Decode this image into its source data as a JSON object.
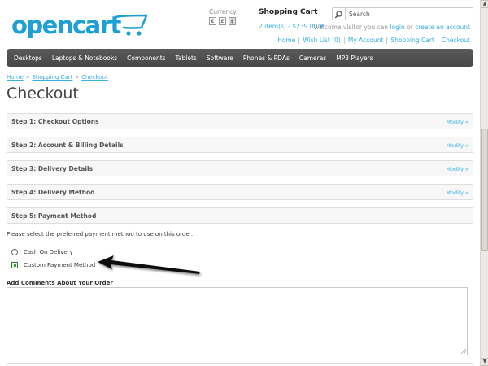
{
  "header": {
    "logo_text": "opencart",
    "currency_label": "Currency",
    "currencies": [
      "€",
      "£",
      "$"
    ],
    "cart_title": "Shopping Cart",
    "cart_summary": "2 item(s) - $239.00",
    "search_placeholder": "Search",
    "welcome_prefix": "Welcome visitor you can",
    "welcome_login": "login",
    "welcome_or": "or",
    "welcome_register": "create an account",
    "links": [
      "Home",
      "Wish List (0)",
      "My Account",
      "Shopping Cart",
      "Checkout"
    ]
  },
  "menu": [
    "Desktops",
    "Laptops & Notebooks",
    "Components",
    "Tablets",
    "Software",
    "Phones & PDAs",
    "Cameras",
    "MP3 Players"
  ],
  "breadcrumb": [
    "Home",
    "Shopping Cart",
    "Checkout"
  ],
  "breadcrumb_separator": "»",
  "page_title": "Checkout",
  "steps": [
    {
      "title": "Step 1: Checkout Options",
      "modify": "Modify »"
    },
    {
      "title": "Step 2: Account & Billing Details",
      "modify": "Modify »"
    },
    {
      "title": "Step 3: Delivery Details",
      "modify": "Modify »"
    },
    {
      "title": "Step 4: Delivery Method",
      "modify": "Modify »"
    },
    {
      "title": "Step 5: Payment Method",
      "modify": ""
    }
  ],
  "payment": {
    "instruction": "Please select the preferred payment method to use on this order.",
    "options": [
      {
        "label": "Cash On Delivery",
        "selected": false
      },
      {
        "label": "Custom Payment Method",
        "selected": true
      }
    ]
  },
  "comments": {
    "label": "Add Comments About Your Order",
    "value": ""
  },
  "colors": {
    "brand": "#1da0d6",
    "link": "#38b0e3",
    "menu_bg": "#4f4f4f"
  }
}
